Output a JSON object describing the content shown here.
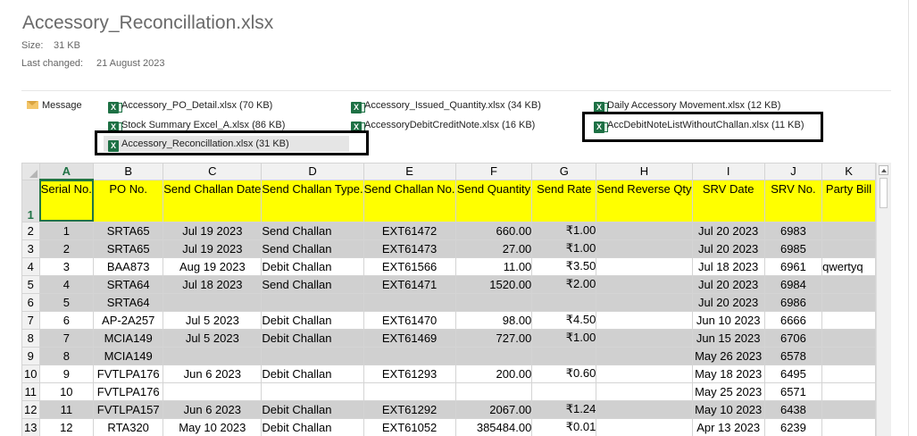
{
  "file": {
    "title": "Accessory_Reconcillation.xlsx",
    "size_label": "Size:",
    "size_value": "31 KB",
    "changed_label": "Last changed:",
    "changed_value": "21 August 2023"
  },
  "attachments": {
    "message_label": "Message",
    "items": [
      "Accessory_PO_Detail.xlsx (70 KB)",
      "Accessory_Issued_Quantity.xlsx (34 KB)",
      "Daily Accessory Movement.xlsx (12 KB)",
      "Stock Summary Excel_A.xlsx (86 KB)",
      "AccessoryDebitCreditNote.xlsx (16 KB)",
      "AccDebitNoteListWithoutChallan.xlsx (11 KB)",
      "Accessory_Reconcillation.xlsx (31 KB)"
    ]
  },
  "sheet": {
    "columns": [
      "A",
      "B",
      "C",
      "D",
      "E",
      "F",
      "G",
      "H",
      "I",
      "J",
      "K"
    ],
    "headers": [
      "Serial No.",
      "PO No.",
      "Send Challan Date",
      "Send Challan Type.",
      "Send Challan No.",
      "Send Quantity",
      "Send Rate",
      "Send Reverse Qty",
      "SRV Date",
      "SRV No.",
      "Party Bill"
    ],
    "header_row_number": "1",
    "rows": [
      {
        "n": "2",
        "shade": "gray",
        "cells": [
          "1",
          "SRTA65",
          "Jul 19 2023",
          "Send Challan",
          "EXT61472",
          "660.00",
          "₹1.00",
          "",
          "Jul 20 2023",
          "6983",
          ""
        ]
      },
      {
        "n": "3",
        "shade": "gray",
        "cells": [
          "2",
          "SRTA65",
          "Jul 19 2023",
          "Send Challan",
          "EXT61473",
          "27.00",
          "₹1.00",
          "",
          "Jul 20 2023",
          "6985",
          ""
        ]
      },
      {
        "n": "4",
        "shade": "white",
        "cells": [
          "3",
          "BAA873",
          "Aug 19 2023",
          "Debit Challan",
          "EXT61566",
          "11.00",
          "₹3.50",
          "",
          "Jul 18 2023",
          "6961",
          "qwertyq"
        ]
      },
      {
        "n": "5",
        "shade": "gray",
        "cells": [
          "4",
          "SRTA64",
          "Jul 18 2023",
          "Send Challan",
          "EXT61471",
          "1520.00",
          "₹2.00",
          "",
          "Jul 20 2023",
          "6984",
          ""
        ]
      },
      {
        "n": "6",
        "shade": "gray",
        "cells": [
          "5",
          "SRTA64",
          "",
          "",
          "",
          "",
          "",
          "",
          "Jul 20 2023",
          "6986",
          ""
        ]
      },
      {
        "n": "7",
        "shade": "white",
        "cells": [
          "6",
          "AP-2A257",
          "Jul  5 2023",
          "Debit Challan",
          "EXT61470",
          "98.00",
          "₹4.50",
          "",
          "Jun 10 2023",
          "6666",
          ""
        ]
      },
      {
        "n": "8",
        "shade": "gray",
        "cells": [
          "7",
          "MCIA149",
          "Jul  5 2023",
          "Debit Challan",
          "EXT61469",
          "727.00",
          "₹1.00",
          "",
          "Jun 15 2023",
          "6706",
          ""
        ]
      },
      {
        "n": "9",
        "shade": "gray",
        "cells": [
          "8",
          "MCIA149",
          "",
          "",
          "",
          "",
          "",
          "",
          "May 26 2023",
          "6578",
          ""
        ]
      },
      {
        "n": "10",
        "shade": "white",
        "cells": [
          "9",
          "FVTLPA176",
          "Jun  6 2023",
          "Debit Challan",
          "EXT61293",
          "200.00",
          "₹0.60",
          "",
          "May 18 2023",
          "6495",
          ""
        ]
      },
      {
        "n": "11",
        "shade": "white",
        "cells": [
          "10",
          "FVTLPA176",
          "",
          "",
          "",
          "",
          "",
          "",
          "May 25 2023",
          "6571",
          ""
        ]
      },
      {
        "n": "12",
        "shade": "gray",
        "cells": [
          "11",
          "FVTLPA157",
          "Jun  6 2023",
          "Debit Challan",
          "EXT61292",
          "2067.00",
          "₹1.24",
          "",
          "May 10 2023",
          "6438",
          ""
        ]
      },
      {
        "n": "13",
        "shade": "white",
        "cells": [
          "12",
          "RTA320",
          "May 10 2023",
          "Debit Challan",
          "EXT61052",
          "385484.00",
          "₹0.01",
          "",
          "Apr 13 2023",
          "6239",
          ""
        ]
      }
    ]
  }
}
